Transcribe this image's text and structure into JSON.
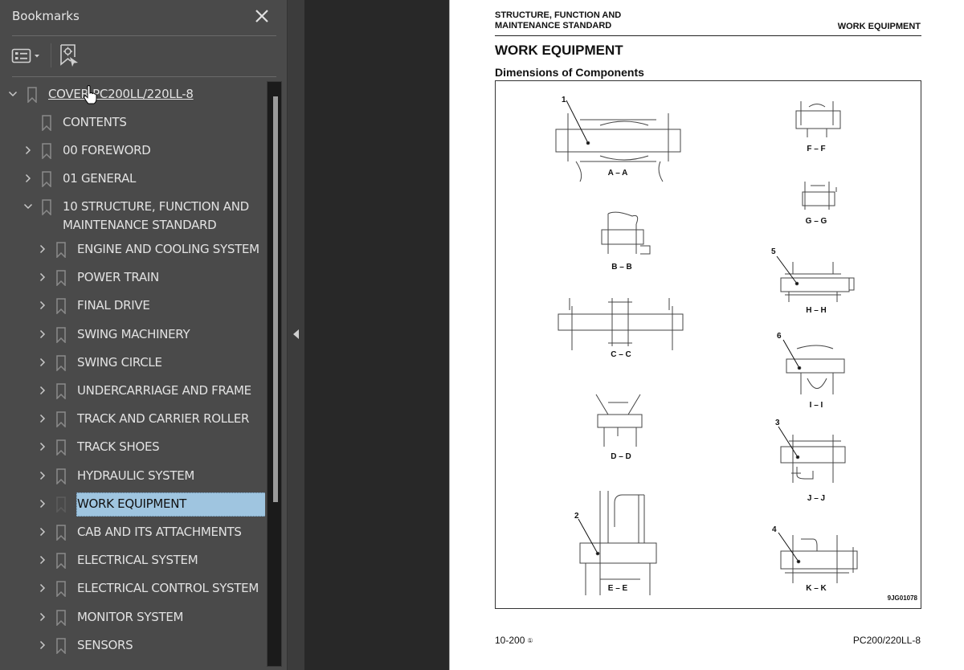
{
  "bookmarks_panel": {
    "title": "Bookmarks",
    "close_icon": "close-icon",
    "toolbar": {
      "options_icon": "list-options-icon",
      "find_bookmark_icon": "find-current-bookmark-icon"
    },
    "items": [
      {
        "label": "COVER PC200LL/220LL-8",
        "level": 0,
        "expanded": true,
        "has_children": true,
        "link": true
      },
      {
        "label": "CONTENTS",
        "level": 1,
        "has_children": false
      },
      {
        "label": "00 FOREWORD",
        "level": 1,
        "has_children": true,
        "expanded": false
      },
      {
        "label": "01 GENERAL",
        "level": 1,
        "has_children": true,
        "expanded": false
      },
      {
        "label": "10 STRUCTURE, FUNCTION AND",
        "label_line2": "MAINTENANCE STANDARD",
        "level": 1,
        "has_children": true,
        "expanded": true
      },
      {
        "label": "ENGINE AND COOLING SYSTEM",
        "level": 2,
        "has_children": true
      },
      {
        "label": "POWER TRAIN",
        "level": 2,
        "has_children": true
      },
      {
        "label": "FINAL DRIVE",
        "level": 2,
        "has_children": true
      },
      {
        "label": "SWING MACHINERY",
        "level": 2,
        "has_children": true
      },
      {
        "label": "SWING CIRCLE",
        "level": 2,
        "has_children": true
      },
      {
        "label": "UNDERCARRIAGE AND FRAME",
        "level": 2,
        "has_children": true
      },
      {
        "label": "TRACK AND CARRIER ROLLER",
        "level": 2,
        "has_children": true
      },
      {
        "label": "TRACK SHOES",
        "level": 2,
        "has_children": true
      },
      {
        "label": "HYDRAULIC SYSTEM",
        "level": 2,
        "has_children": true
      },
      {
        "label": "WORK EQUIPMENT",
        "level": 2,
        "has_children": true,
        "selected": true
      },
      {
        "label": "CAB AND ITS ATTACHMENTS",
        "level": 2,
        "has_children": true
      },
      {
        "label": "ELECTRICAL SYSTEM",
        "level": 2,
        "has_children": true
      },
      {
        "label": "ELECTRICAL CONTROL SYSTEM",
        "level": 2,
        "has_children": true
      },
      {
        "label": "MONITOR SYSTEM",
        "level": 2,
        "has_children": true
      },
      {
        "label": "SENSORS",
        "level": 2,
        "has_children": true
      }
    ],
    "selection_color": "#9fc5e0"
  },
  "document": {
    "header_left_line1": "STRUCTURE, FUNCTION AND",
    "header_left_line2": "MAINTENANCE STANDARD",
    "header_right": "WORK EQUIPMENT",
    "title": "WORK EQUIPMENT",
    "section": "Dimensions of Components",
    "figure": {
      "sections": [
        "A – A",
        "B – B",
        "C – C",
        "D – D",
        "E – E",
        "F – F",
        "G – G",
        "H – H",
        "I – I",
        "J – J",
        "K – K"
      ],
      "callouts": [
        "1",
        "2",
        "3",
        "4",
        "5",
        "6"
      ],
      "figure_id": "9JG01078"
    },
    "footer_left": "10-200",
    "footer_rev": "①",
    "footer_right": "PC200/220LL-8"
  }
}
